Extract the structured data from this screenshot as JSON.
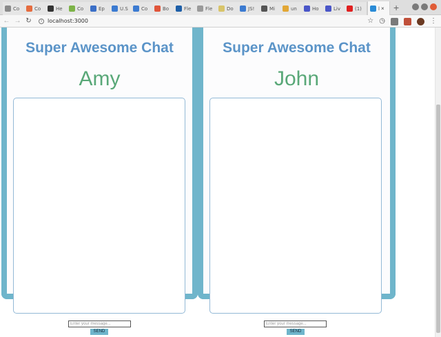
{
  "browser": {
    "tabs": [
      {
        "title": "Co",
        "color": "#8a8a8a"
      },
      {
        "title": "Co",
        "color": "#e56c3f"
      },
      {
        "title": "He",
        "color": "#333333"
      },
      {
        "title": "Co",
        "color": "#7db348"
      },
      {
        "title": "Ep",
        "color": "#3b6fc7"
      },
      {
        "title": "U.S",
        "color": "#3c7bd1"
      },
      {
        "title": "Co",
        "color": "#3c7bd1"
      },
      {
        "title": "Bo",
        "color": "#e0553a"
      },
      {
        "title": "Fle",
        "color": "#1e5fa8"
      },
      {
        "title": "Fle",
        "color": "#9a9a9a"
      },
      {
        "title": "Do",
        "color": "#d8c46a"
      },
      {
        "title": "JS!",
        "color": "#3c7bd1"
      },
      {
        "title": "Mi",
        "color": "#555555"
      },
      {
        "title": "un",
        "color": "#e2a735"
      },
      {
        "title": "Ho",
        "color": "#4a56c8"
      },
      {
        "title": "Liv",
        "color": "#4a56c8"
      },
      {
        "title": "(1)",
        "color": "#e02020"
      },
      {
        "title": "l",
        "color": "#2a8bd6"
      }
    ],
    "new_tab": "+",
    "url": "localhost:3000",
    "star": "☆"
  },
  "chat": {
    "title": "Super Awesome Chat",
    "users": [
      "Amy",
      "John"
    ],
    "message_placeholder": "Enter your message...",
    "send_label": "SEND"
  },
  "colors": {
    "panel_border": "#6fb5cb",
    "title": "#5b94c8",
    "username": "#59a878"
  }
}
